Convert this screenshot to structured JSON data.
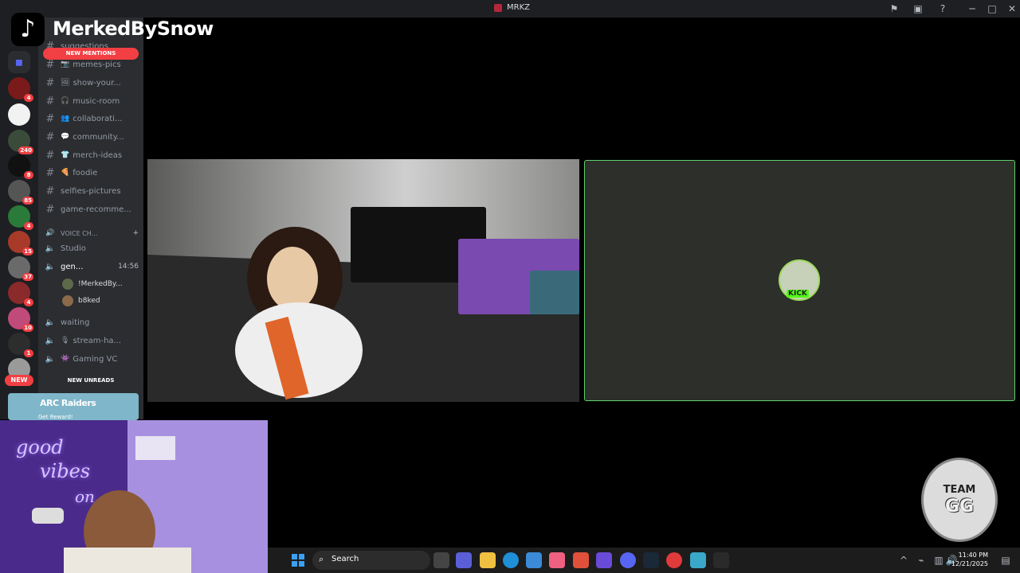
{
  "window": {
    "title": "MRKZ"
  },
  "overlay": {
    "streamer_name": "MerkedBySnow",
    "team_badge_top": "TEAM",
    "team_badge_main": "GG"
  },
  "guilds": {
    "badges": [
      "4",
      "240",
      "8",
      "85",
      "4",
      "15",
      "37",
      "4",
      "10",
      "1"
    ],
    "new_label": "NEW"
  },
  "channels": {
    "new_mentions": "NEW MENTIONS",
    "new_unreads": "NEW UNREADS",
    "top_partial": "suggestions",
    "text_channels": [
      {
        "emoji": "📷",
        "label": "memes-pics"
      },
      {
        "emoji": "🖼",
        "label": "show-your..."
      },
      {
        "emoji": "🎧",
        "label": "music-room"
      },
      {
        "emoji": "👥",
        "label": "collaborati..."
      },
      {
        "emoji": "💬",
        "label": "community..."
      },
      {
        "emoji": "👕",
        "label": "merch-ideas"
      },
      {
        "emoji": "🍕",
        "label": "foodie"
      },
      {
        "emoji": "",
        "label": "selfies-pictures"
      },
      {
        "emoji": "",
        "label": "game-recomme..."
      }
    ],
    "voice_category": "VOICE CH...",
    "voice_channels": [
      {
        "label": "Studio",
        "timer": ""
      },
      {
        "label": "gen...",
        "timer": "14:56"
      }
    ],
    "voice_users": [
      {
        "name": "!MerkedBy..."
      },
      {
        "name": "b8ked"
      }
    ],
    "voice_channels_more": [
      {
        "emoji": "",
        "label": "waiting"
      },
      {
        "emoji": "🎙",
        "label": "stream-ha..."
      },
      {
        "emoji": "👾",
        "label": "Gaming VC"
      }
    ],
    "promo": {
      "brand": "ARC Raiders",
      "cta": "Get Reward!"
    }
  },
  "call": {
    "avatar_tag": "KICK"
  },
  "webcam": {
    "neon_line1": "good",
    "neon_line2": "vibes",
    "neon_line3": "on"
  },
  "taskbar": {
    "search_placeholder": "Search",
    "time": "11:40 PM",
    "date": "12/21/2025"
  },
  "colors": {
    "accent_green": "#5fd16b",
    "mention_red": "#f23f43",
    "discord_bg": "#2b2d31"
  }
}
